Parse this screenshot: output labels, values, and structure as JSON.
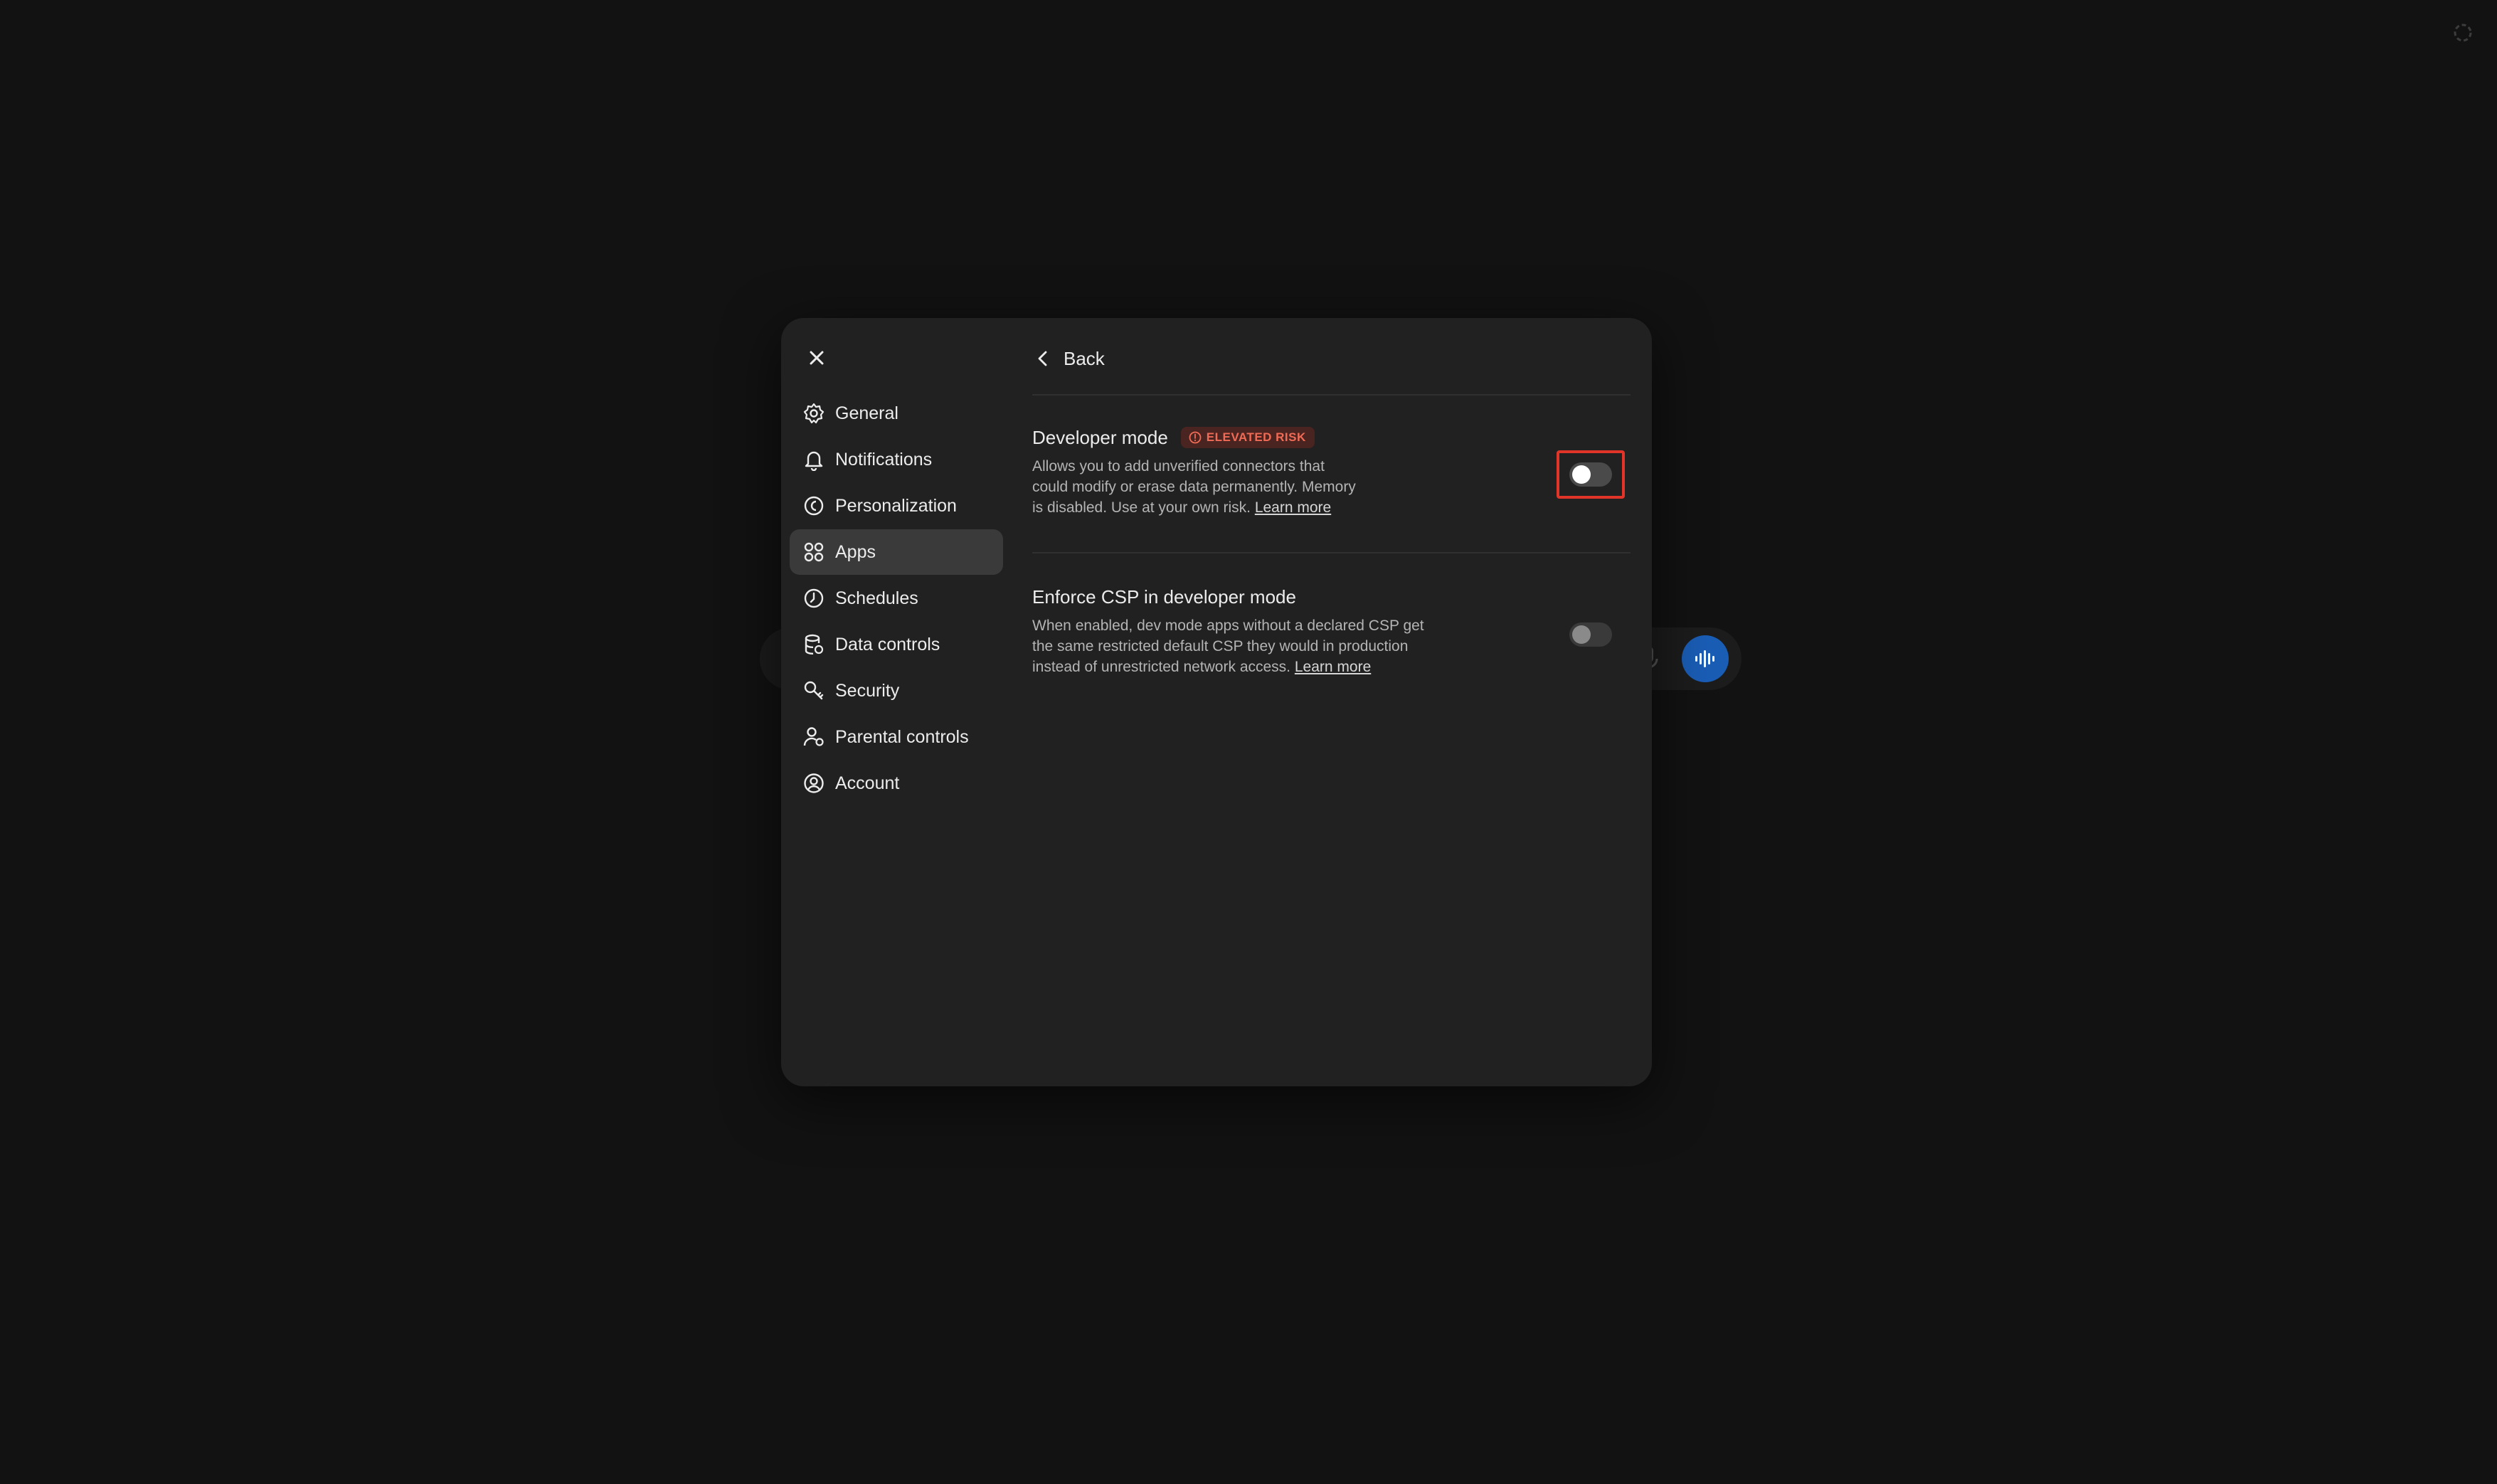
{
  "background": {
    "corner_icon": "loading-spinner-icon",
    "voice_button_color": "#1a5db5"
  },
  "modal": {
    "close_icon": "close-icon",
    "sidebar": {
      "items": [
        {
          "label": "General",
          "icon": "gear-icon",
          "active": false
        },
        {
          "label": "Notifications",
          "icon": "bell-icon",
          "active": false
        },
        {
          "label": "Personalization",
          "icon": "personalization-icon",
          "active": false
        },
        {
          "label": "Apps",
          "icon": "apps-grid-icon",
          "active": true
        },
        {
          "label": "Schedules",
          "icon": "clock-icon",
          "active": false
        },
        {
          "label": "Data controls",
          "icon": "database-icon",
          "active": false
        },
        {
          "label": "Security",
          "icon": "key-icon",
          "active": false
        },
        {
          "label": "Parental controls",
          "icon": "parental-icon",
          "active": false
        },
        {
          "label": "Account",
          "icon": "user-circle-icon",
          "active": false
        }
      ]
    },
    "header": {
      "back_label": "Back"
    },
    "settings": {
      "developer_mode": {
        "title": "Developer mode",
        "badge": "ELEVATED RISK",
        "desc_line1": "Allows you to add unverified connectors that",
        "desc_line2": "could modify or erase data permanently. Memory",
        "desc_line3": "is disabled. Use at your own risk.",
        "link": "Learn more",
        "enabled": false
      },
      "enforce_csp": {
        "title": "Enforce CSP in developer mode",
        "desc_line1": "When enabled, dev mode apps without a declared CSP get",
        "desc_line2": "the same restricted default CSP they would in production",
        "desc_line3": "instead of unrestricted network access.",
        "link": "Learn more",
        "enabled": false
      }
    },
    "colors": {
      "badge_text": "#f06b56",
      "badge_bg": "#4a2420",
      "highlight_box": "#e2352a",
      "active_nav_bg": "#3a3a3a"
    }
  }
}
